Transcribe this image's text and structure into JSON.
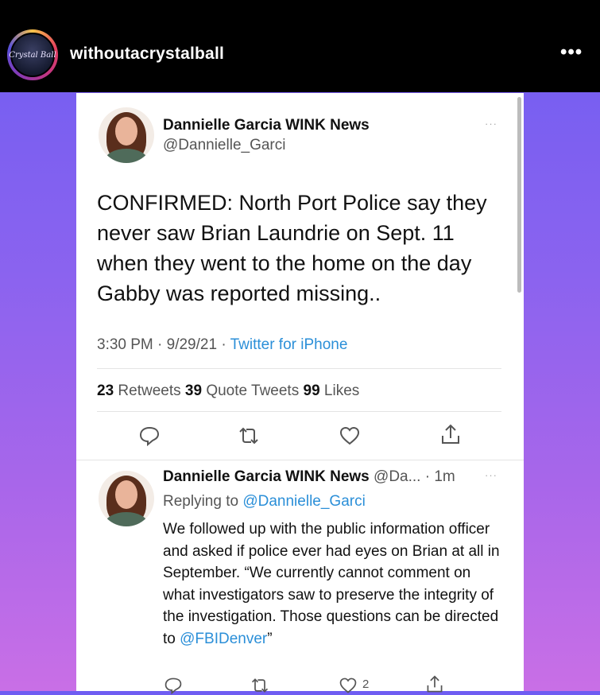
{
  "post": {
    "username": "withoutacrystalball",
    "avatar_text": "Crystal Ball",
    "more_label": "•••"
  },
  "tweet": {
    "author_name": "Dannielle Garcia WINK News",
    "author_handle": "@Dannielle_Garci",
    "more_label": "···",
    "text": "CONFIRMED: North Port Police say they never saw Brian Laundrie on Sept. 11 when they went to the home on the day Gabby was reported missing..",
    "time": "3:30 PM · 9/29/21 · ",
    "source": "Twitter for iPhone",
    "retweets_count": "23",
    "retweets_label": " Retweets ",
    "quotes_count": "39",
    "quotes_label": " Quote Tweets ",
    "likes_count": "99",
    "likes_label": " Likes"
  },
  "reply": {
    "author_name": "Dannielle Garcia WINK News",
    "author_handle_time": " @Da... · 1m",
    "more_label": "···",
    "replying_prefix": "Replying to ",
    "replying_handle": "@Dannielle_Garci",
    "text": "We followed up with the public information officer and asked if police ever had eyes on Brian at all in September. “We currently cannot comment on what investigators saw to preserve the integrity of the investigation. Those questions can be directed to ",
    "text_link": "@FBIDenver",
    "text_end": "”",
    "likes_count": "2"
  },
  "colors": {
    "link": "#2b8fd8",
    "background_top": "#6f5df2",
    "background_bottom": "#c96fe6"
  },
  "icons": [
    "reply-icon",
    "retweet-icon",
    "like-icon",
    "share-icon"
  ]
}
